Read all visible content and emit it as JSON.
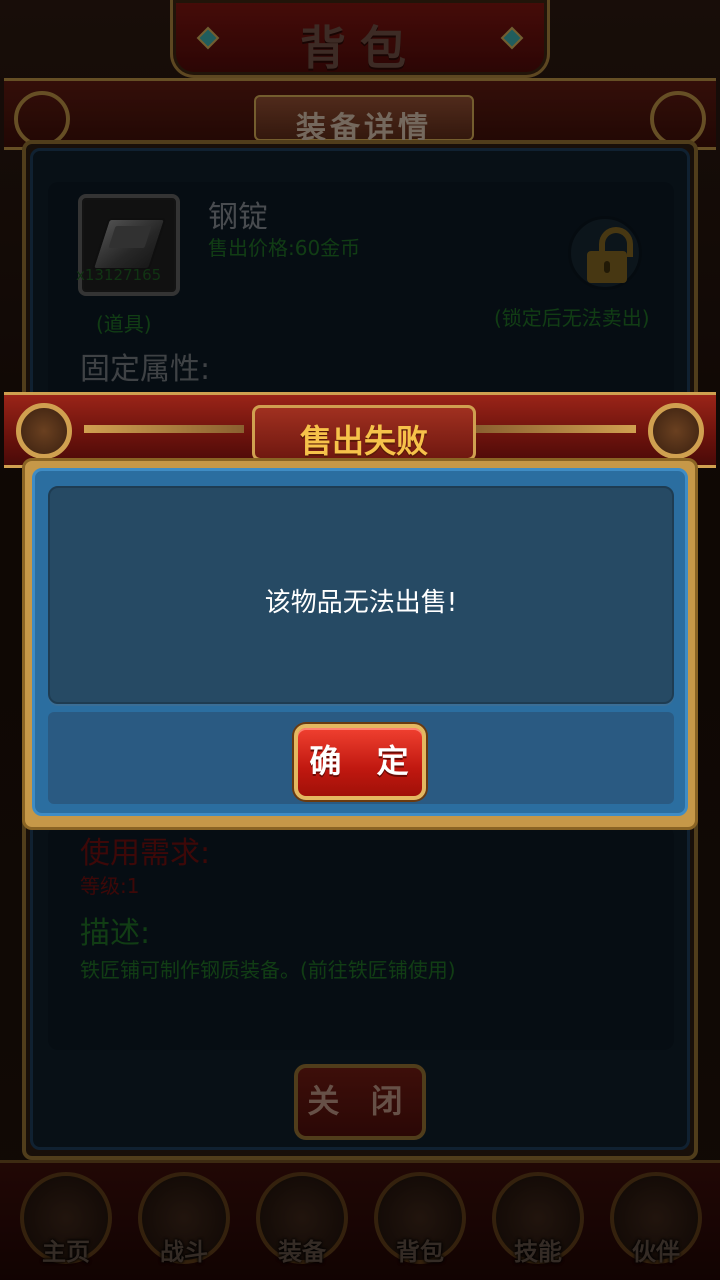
{
  "screen": {
    "title": "背包",
    "detail_title": "装备详情"
  },
  "item": {
    "name": "钢锭",
    "price": "售出价格:60金币",
    "count": "x13127165",
    "type": "(道具)",
    "icon": "steel-ingot",
    "lock_note": "(锁定后无法卖出)",
    "fixed_attr_label": "固定属性:",
    "requirement_label": "使用需求:",
    "requirement_level": "等级:1",
    "description_label": "描述:",
    "description": "铁匠铺可制作钢质装备。(前往铁匠铺使用)"
  },
  "close_button": "关 闭",
  "dialog": {
    "title": "售出失败",
    "message": "该物品无法出售!",
    "confirm_label": "确 定"
  },
  "nav": [
    {
      "label": "主页",
      "icon": "home-icon"
    },
    {
      "label": "战斗",
      "icon": "battle-icon"
    },
    {
      "label": "装备",
      "icon": "equipment-icon"
    },
    {
      "label": "背包",
      "icon": "bag-icon"
    },
    {
      "label": "技能",
      "icon": "skill-icon"
    },
    {
      "label": "伙伴",
      "icon": "partner-icon"
    }
  ],
  "colors": {
    "dialog_title": "#f6c24a",
    "dialog_body": "#2b6ea0",
    "confirm_button": "#d8281a",
    "green_text": "#1e6a24",
    "red_text": "#6a0f0f"
  }
}
